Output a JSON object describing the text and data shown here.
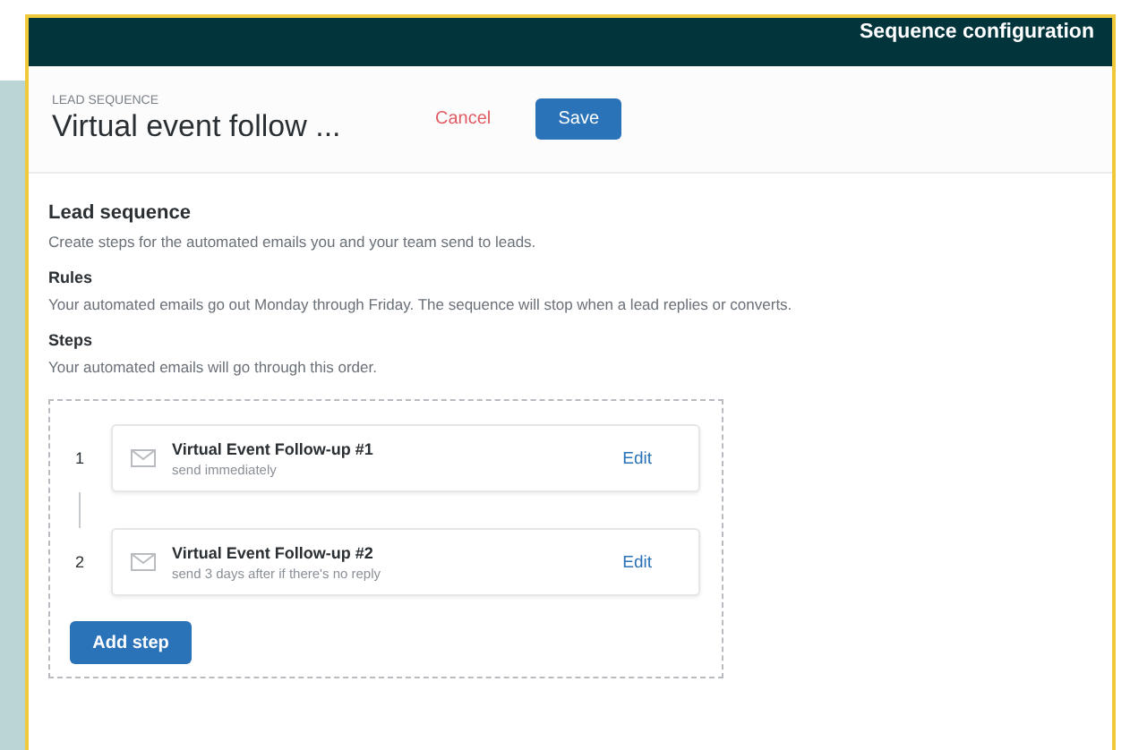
{
  "header": {
    "title": "Sequence configuration"
  },
  "sequence": {
    "label": "LEAD SEQUENCE",
    "name": "Virtual event follow ...",
    "cancel": "Cancel",
    "save": "Save"
  },
  "intro": {
    "heading": "Lead sequence",
    "text": "Create steps for the automated emails you and your team send to leads."
  },
  "rules": {
    "heading": "Rules",
    "text": "Your automated emails go out Monday through Friday. The sequence will stop when a lead replies or converts."
  },
  "steps": {
    "heading": "Steps",
    "text": "Your automated emails will go through this order.",
    "items": [
      {
        "number": "1",
        "title": "Virtual Event Follow-up #1",
        "timing": "send immediately",
        "action": "Edit"
      },
      {
        "number": "2",
        "title": "Virtual Event Follow-up #2",
        "timing": "send 3 days after if there's no reply",
        "action": "Edit"
      }
    ],
    "add": "Add step"
  }
}
